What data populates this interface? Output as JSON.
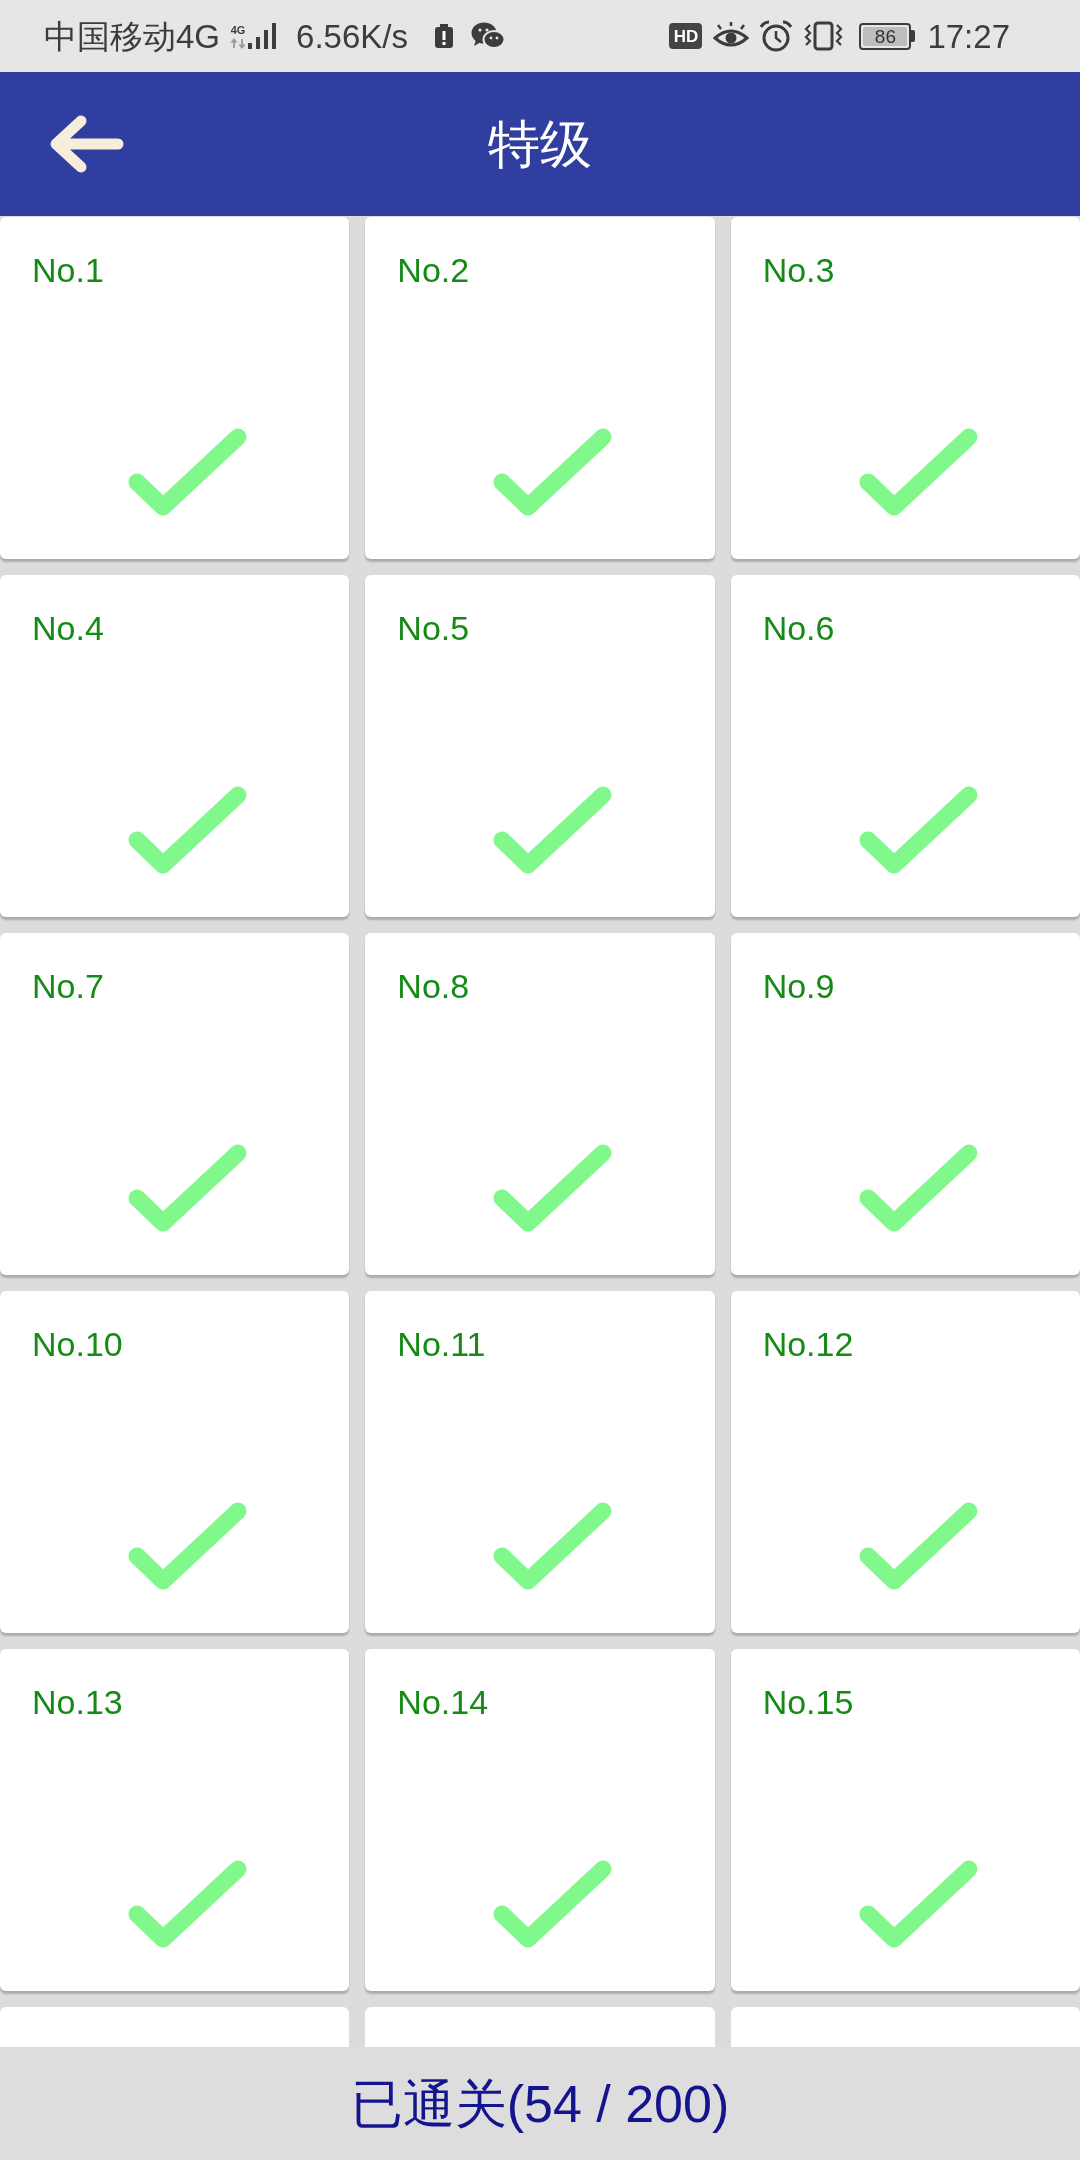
{
  "status_bar": {
    "carrier": "中国移动4G",
    "network_label": "4G",
    "speed": "6.56K/s",
    "hd_badge": "HD",
    "battery_level": "86",
    "time": "17:27"
  },
  "header": {
    "title": "特级"
  },
  "levels": [
    {
      "kind": "level",
      "label": "No.1",
      "completed": true
    },
    {
      "kind": "level",
      "label": "No.2",
      "completed": true
    },
    {
      "kind": "level",
      "label": "No.3",
      "completed": true
    },
    {
      "kind": "level",
      "label": "No.4",
      "completed": true
    },
    {
      "kind": "level",
      "label": "No.5",
      "completed": true
    },
    {
      "kind": "level",
      "label": "No.6",
      "completed": true
    },
    {
      "kind": "level",
      "label": "No.7",
      "completed": true
    },
    {
      "kind": "level",
      "label": "No.8",
      "completed": true
    },
    {
      "kind": "level",
      "label": "No.9",
      "completed": true
    },
    {
      "kind": "level",
      "label": "No.10",
      "completed": true
    },
    {
      "kind": "level",
      "label": "No.11",
      "completed": true
    },
    {
      "kind": "level",
      "label": "No.12",
      "completed": true
    },
    {
      "kind": "level",
      "label": "No.13",
      "completed": true
    },
    {
      "kind": "level",
      "label": "No.14",
      "completed": true
    },
    {
      "kind": "level",
      "label": "No.15",
      "completed": true
    },
    {
      "kind": "cut_off"
    },
    {
      "kind": "cut_off"
    },
    {
      "kind": "cut_off"
    }
  ],
  "footer": {
    "progress": "已通关(54 / 200)"
  }
}
